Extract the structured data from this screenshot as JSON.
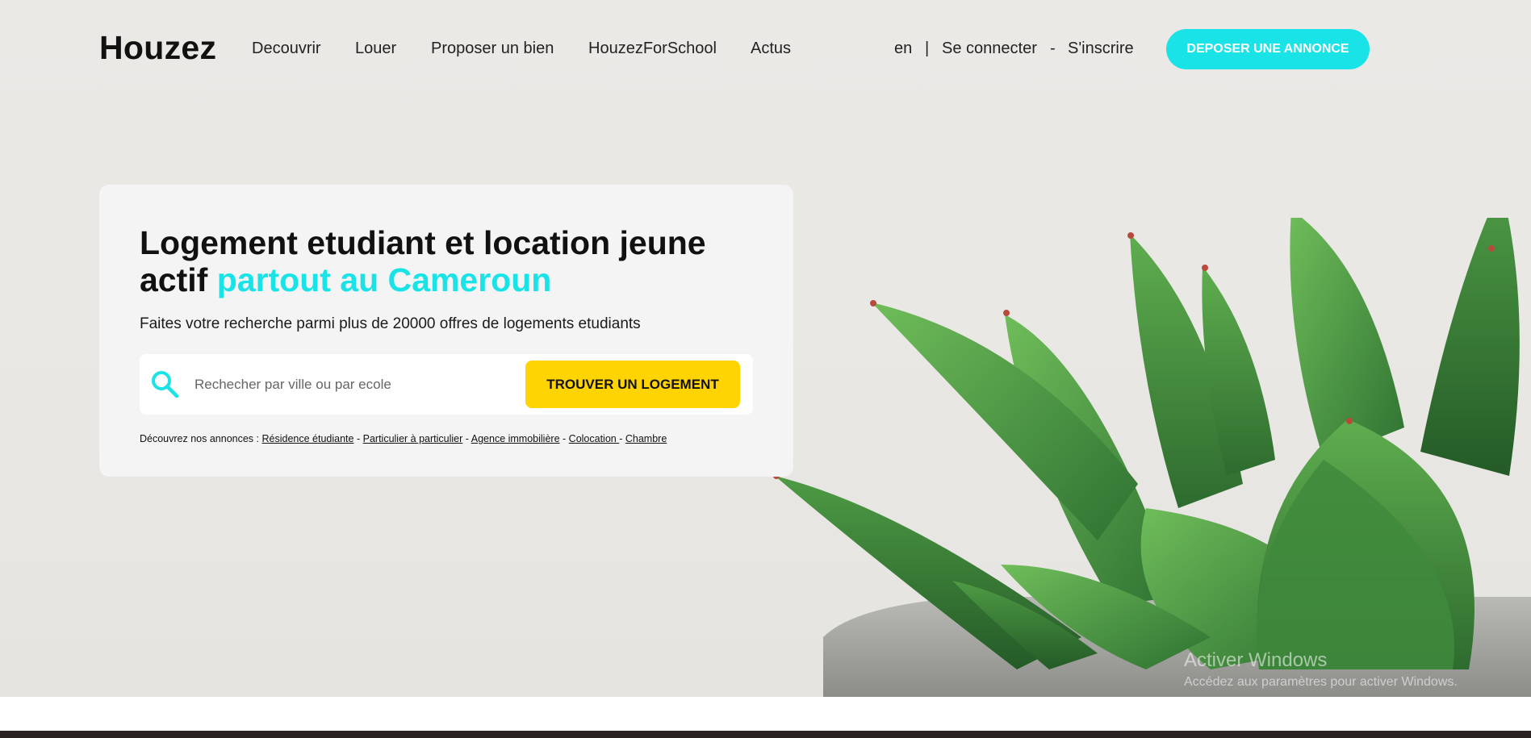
{
  "brand": {
    "name": "Houzez"
  },
  "nav": {
    "items": [
      "Decouvrir",
      "Louer",
      "Proposer un bien",
      "HouzezForSchool",
      "Actus"
    ]
  },
  "header": {
    "lang": "en",
    "sep1": "|",
    "login": "Se connecter",
    "sep2": "-",
    "signup": "S'inscrire",
    "cta": "DEPOSER UNE ANNONCE"
  },
  "hero": {
    "title_main": "Logement etudiant et location jeune actif",
    "title_accent": "partout au Cameroun",
    "subtitle": "Faites votre recherche parmi plus de 20000 offres de logements etudiants",
    "search": {
      "placeholder": "Rechecher par ville ou par ecole",
      "button": "TROUVER UN LOGEMENT"
    },
    "quick_links": {
      "label": "Découvrez nos annonces :",
      "links": [
        "Résidence étudiante",
        "Particulier à particulier",
        "Agence immobilière",
        "Colocation ",
        "Chambre"
      ],
      "separator": "-"
    }
  },
  "watermark": {
    "title": "Activer Windows",
    "subtitle": "Accédez aux paramètres pour activer Windows."
  },
  "colors": {
    "accent": "#1ae3e8",
    "button_yellow": "#ffd400",
    "hero_bg": "#ebe9e6",
    "card_bg": "#f4f4f4"
  },
  "icons": {
    "search": "search-icon"
  }
}
